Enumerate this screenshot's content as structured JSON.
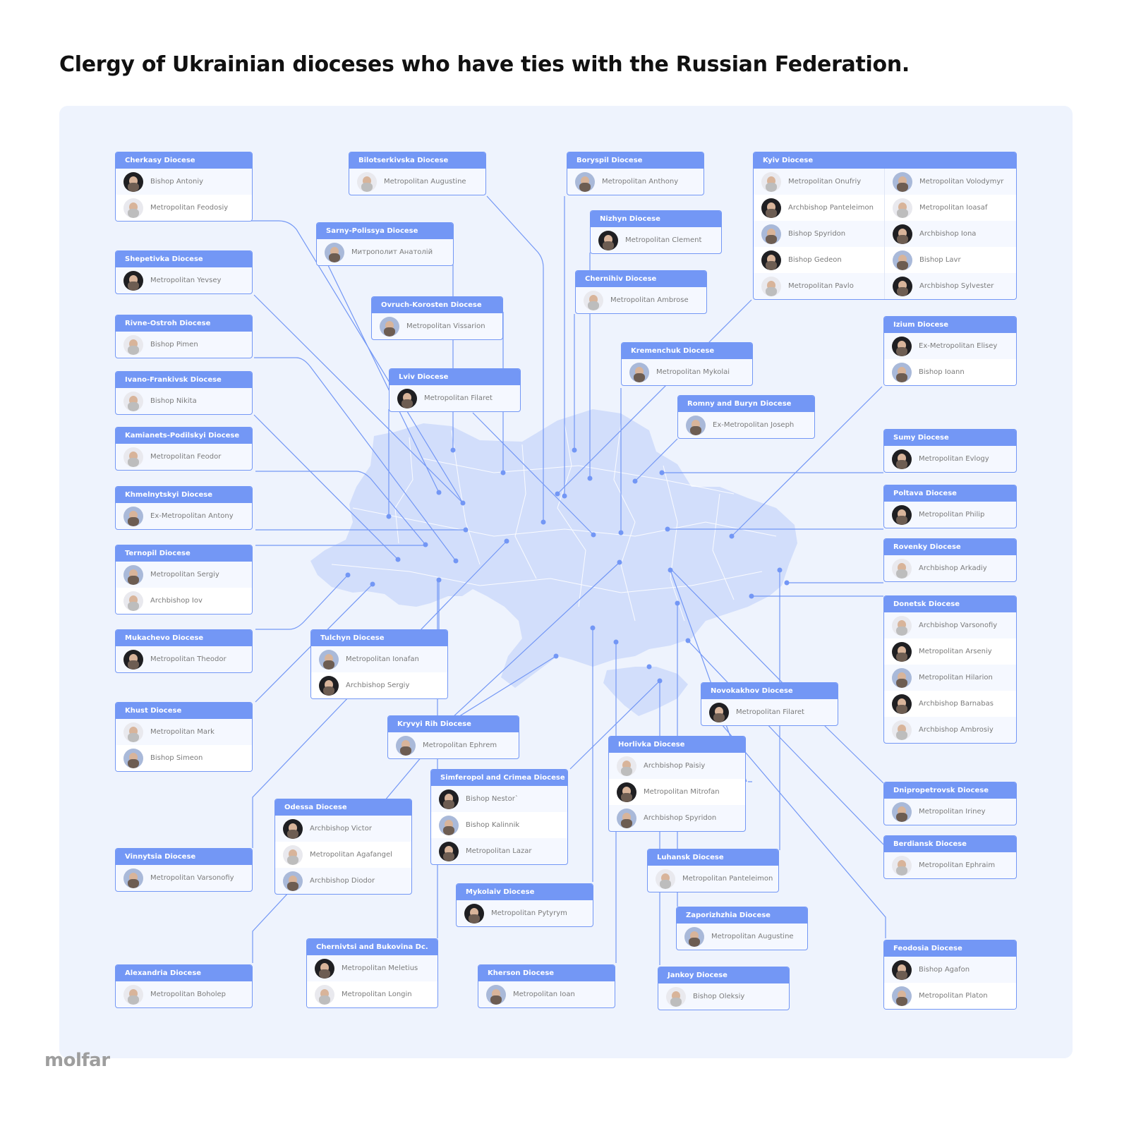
{
  "title": "Clergy of Ukrainian dioceses who have ties with the Russian Federation.",
  "logo": "molfar",
  "colors": {
    "accent": "#7397f5",
    "panel_background": "#eef3fd",
    "map_fill": "#d2defb",
    "card_background": "#f5f8ff",
    "name_text": "#7b7b7b"
  },
  "dioceses": [
    {
      "id": "cherkasy",
      "name": "Cherkasy Diocese",
      "clergy": [
        "Bishop Antoniy",
        "Metropolitan Feodosiy"
      ]
    },
    {
      "id": "bilotserkivska",
      "name": "Bilotserkivska Diocese",
      "clergy": [
        "Metropolitan Augustine"
      ]
    },
    {
      "id": "boryspil",
      "name": "Boryspil Diocese",
      "clergy": [
        "Metropolitan Anthony"
      ]
    },
    {
      "id": "kyiv",
      "name": "Kyiv Diocese",
      "clergy": [
        "Metropolitan Onufriy",
        "Archbishop Panteleimon",
        "Bishop Spyridon",
        "Bishop Gedeon",
        "Metropolitan Pavlo",
        "Metropolitan Volodymyr",
        "Metropolitan Ioasaf",
        "Archbishop Iona",
        "Bishop Lavr",
        "Archbishop Sylvester"
      ]
    },
    {
      "id": "nizhyn",
      "name": "Nizhyn Diocese",
      "clergy": [
        "Metropolitan Clement"
      ]
    },
    {
      "id": "sarny",
      "name": "Sarny-Polissya Diocese",
      "clergy": [
        "Митрополит Анатолій"
      ]
    },
    {
      "id": "shepetivka",
      "name": "Shepetivka Diocese",
      "clergy": [
        "Metropolitan Yevsey"
      ]
    },
    {
      "id": "chernihiv",
      "name": "Chernihiv Diocese",
      "clergy": [
        "Metropolitan Ambrose"
      ]
    },
    {
      "id": "ovruch",
      "name": "Ovruch-Korosten Diocese",
      "clergy": [
        "Metropolitan Vissarion"
      ]
    },
    {
      "id": "rivne",
      "name": "Rivne-Ostroh Diocese",
      "clergy": [
        "Bishop Pimen"
      ]
    },
    {
      "id": "izium",
      "name": "Izium Diocese",
      "clergy": [
        "Ex-Metropolitan Elisey",
        "Bishop Ioann"
      ]
    },
    {
      "id": "kremenchuk",
      "name": "Kremenchuk Diocese",
      "clergy": [
        "Metropolitan Mykolai"
      ]
    },
    {
      "id": "lviv",
      "name": "Lviv Diocese",
      "clergy": [
        "Metropolitan Filaret"
      ]
    },
    {
      "id": "ivanofrankivsk",
      "name": "Ivano-Frankivsk Diocese",
      "clergy": [
        "Bishop Nikita"
      ]
    },
    {
      "id": "romny",
      "name": "Romny and Buryn Diocese",
      "clergy": [
        "Ex-Metropolitan Joseph"
      ]
    },
    {
      "id": "kamianets",
      "name": "Kamianets-Podilskyi Diocese",
      "clergy": [
        "Metropolitan Feodor"
      ]
    },
    {
      "id": "sumy",
      "name": "Sumy Diocese",
      "clergy": [
        "Metropolitan Evlogy"
      ]
    },
    {
      "id": "khmelnytskyi",
      "name": "Khmelnytskyi Diocese",
      "clergy": [
        "Ex-Metropolitan Antony"
      ]
    },
    {
      "id": "poltava",
      "name": "Poltava Diocese",
      "clergy": [
        "Metropolitan Philip"
      ]
    },
    {
      "id": "rovenky",
      "name": "Rovenky Diocese",
      "clergy": [
        "Archbishop Arkadiy"
      ]
    },
    {
      "id": "ternopil",
      "name": "Ternopil Diocese",
      "clergy": [
        "Metropolitan Sergiy",
        "Archbishop Iov"
      ]
    },
    {
      "id": "donetsk",
      "name": "Donetsk Diocese",
      "clergy": [
        "Archbishop Varsonofiy",
        "Metropolitan Arseniy",
        "Metropolitan Hilarion",
        "Archbishop Barnabas",
        "Archbishop Ambrosiy"
      ]
    },
    {
      "id": "mukachevo",
      "name": "Mukachevo Diocese",
      "clergy": [
        "Metropolitan Theodor"
      ]
    },
    {
      "id": "tulchyn",
      "name": "Tulchyn Diocese",
      "clergy": [
        "Metropolitan Ionafan",
        "Archbishop Sergiy"
      ]
    },
    {
      "id": "novokakhov",
      "name": "Novokakhov Diocese",
      "clergy": [
        "Metropolitan Filaret"
      ]
    },
    {
      "id": "khust",
      "name": "Khust Diocese",
      "clergy": [
        "Metropolitan Mark",
        "Bishop Simeon"
      ]
    },
    {
      "id": "kryvyirih",
      "name": "Kryvyi Rih Diocese",
      "clergy": [
        "Metropolitan Ephrem"
      ]
    },
    {
      "id": "horlivka",
      "name": "Horlivka Diocese",
      "clergy": [
        "Archbishop Paisiy",
        "Metropolitan Mitrofan",
        "Archbishop Spyridon"
      ]
    },
    {
      "id": "simferopol",
      "name": "Simferopol and Crimea Diocese",
      "clergy": [
        "Bishop Nestor`",
        "Bishop Kalinnik",
        "Metropolitan Lazar"
      ]
    },
    {
      "id": "dnipro",
      "name": "Dnipropetrovsk Diocese",
      "clergy": [
        "Metropolitan Iriney"
      ]
    },
    {
      "id": "odessa",
      "name": "Odessa Diocese",
      "clergy": [
        "Archbishop Victor",
        "Metropolitan Agafangel",
        "Archbishop Diodor"
      ]
    },
    {
      "id": "berdiansk",
      "name": "Berdiansk Diocese",
      "clergy": [
        "Metropolitan Ephraim"
      ]
    },
    {
      "id": "vinnytsia",
      "name": "Vinnytsia Diocese",
      "clergy": [
        "Metropolitan Varsonofiy"
      ]
    },
    {
      "id": "luhansk",
      "name": "Luhansk Diocese",
      "clergy": [
        "Metropolitan Panteleimon"
      ]
    },
    {
      "id": "mykolaiv",
      "name": "Mykolaiv Diocese",
      "clergy": [
        "Metropolitan Pytyrym"
      ]
    },
    {
      "id": "zaporizhzhia",
      "name": "Zaporizhzhia Diocese",
      "clergy": [
        "Metropolitan Augustine"
      ]
    },
    {
      "id": "chernivtsi",
      "name": "Chernivtsi and Bukovina Dc.",
      "clergy": [
        "Metropolitan Meletius",
        "Metropolitan Longin"
      ]
    },
    {
      "id": "alexandria",
      "name": "Alexandria Diocese",
      "clergy": [
        "Metropolitan Boholep"
      ]
    },
    {
      "id": "kherson",
      "name": "Kherson Diocese",
      "clergy": [
        "Metropolitan Ioan"
      ]
    },
    {
      "id": "jankoy",
      "name": "Jankoy Diocese",
      "clergy": [
        "Bishop Oleksiy"
      ]
    },
    {
      "id": "feodosia",
      "name": "Feodosia Diocese",
      "clergy": [
        "Bishop Agafon",
        "Metropolitan Platon"
      ]
    }
  ]
}
